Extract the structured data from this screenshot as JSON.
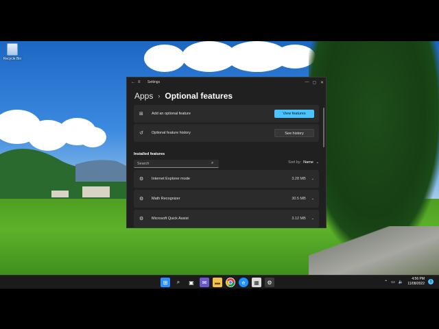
{
  "desktop": {
    "icons": [
      {
        "label": "Recycle Bin",
        "icon": "recycle-bin-icon"
      }
    ]
  },
  "window": {
    "title": "Settings",
    "breadcrumb": {
      "parent": "Apps",
      "separator": "›",
      "current": "Optional features"
    },
    "cards": [
      {
        "icon": "add-feature-icon",
        "label": "Add an optional feature",
        "button": "View features",
        "accent": "#4cc2ff"
      },
      {
        "icon": "history-icon",
        "label": "Optional feature history",
        "button": "See history"
      }
    ],
    "installed": {
      "heading": "Installed features",
      "search_placeholder": "Search",
      "sort_label": "Sort by:",
      "sort_value": "Name",
      "items": [
        {
          "name": "Internet Explorer mode",
          "size": "3.28 MB"
        },
        {
          "name": "Math Recognizer",
          "size": "30.5 MB"
        },
        {
          "name": "Microsoft Quick Assist",
          "size": "3.12 MB"
        }
      ]
    }
  },
  "taskbar": {
    "apps": [
      "start-icon",
      "search-icon",
      "task-view-icon",
      "chat-icon",
      "file-explorer-icon",
      "chrome-icon",
      "edge-icon",
      "store-icon",
      "settings-icon"
    ],
    "clock_time": "4:56 PM",
    "clock_date": "11/08/2022",
    "notifications": "1"
  }
}
